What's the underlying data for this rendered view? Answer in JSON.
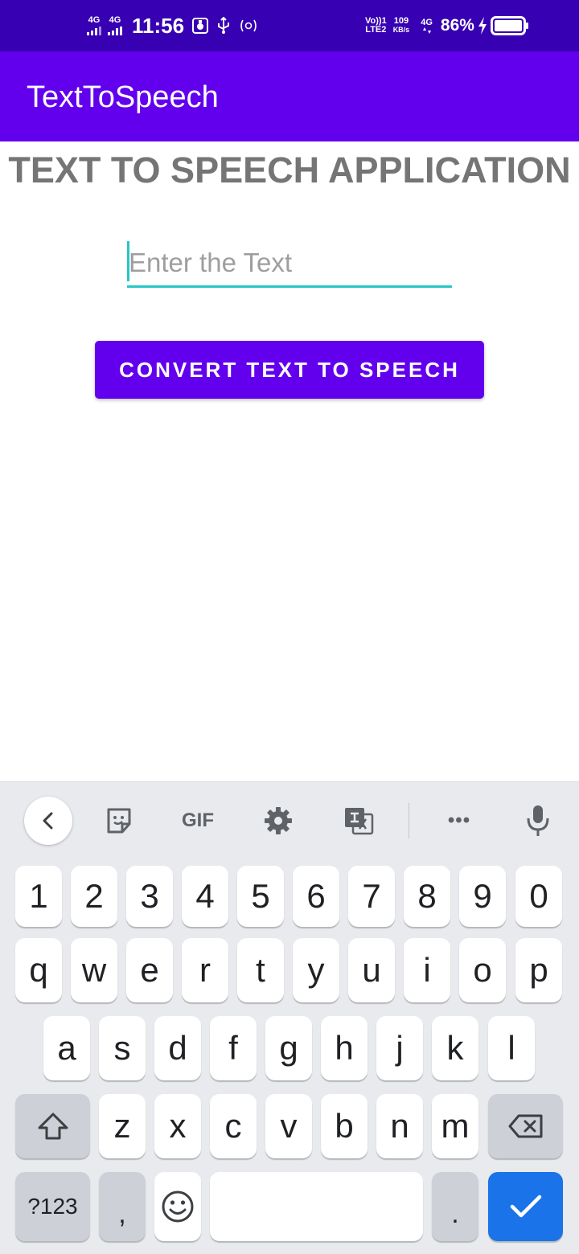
{
  "status_bar": {
    "sim1_label": "4G",
    "sim2_label": "4G",
    "time": "11:56",
    "volte_label": "Vo))1",
    "lte2_label": "LTE2",
    "speed_value": "109",
    "speed_unit": "KB/s",
    "net4g_label": "4G",
    "battery_percent": "86%"
  },
  "app_bar": {
    "title": "TextToSpeech"
  },
  "main": {
    "heading": "TEXT TO SPEECH APPLICATION",
    "input_placeholder": "Enter the Text",
    "input_value": "",
    "convert_button_label": "CONVERT TEXT TO SPEECH"
  },
  "keyboard": {
    "toolbar_gif_label": "GIF",
    "toolbar_more_label": "•••",
    "number_row": [
      "1",
      "2",
      "3",
      "4",
      "5",
      "6",
      "7",
      "8",
      "9",
      "0"
    ],
    "row1": [
      "q",
      "w",
      "e",
      "r",
      "t",
      "y",
      "u",
      "i",
      "o",
      "p"
    ],
    "row2": [
      "a",
      "s",
      "d",
      "f",
      "g",
      "h",
      "j",
      "k",
      "l"
    ],
    "row3": [
      "z",
      "x",
      "c",
      "v",
      "b",
      "n",
      "m"
    ],
    "symbols_label": "?123",
    "comma_label": ",",
    "period_label": "."
  },
  "colors": {
    "status_bar": "#3700b3",
    "primary": "#6200ee",
    "accent": "#26c6c6",
    "heading_text": "#757575",
    "keyboard_bg": "#e8eaed",
    "action_key": "#1a73e8"
  }
}
